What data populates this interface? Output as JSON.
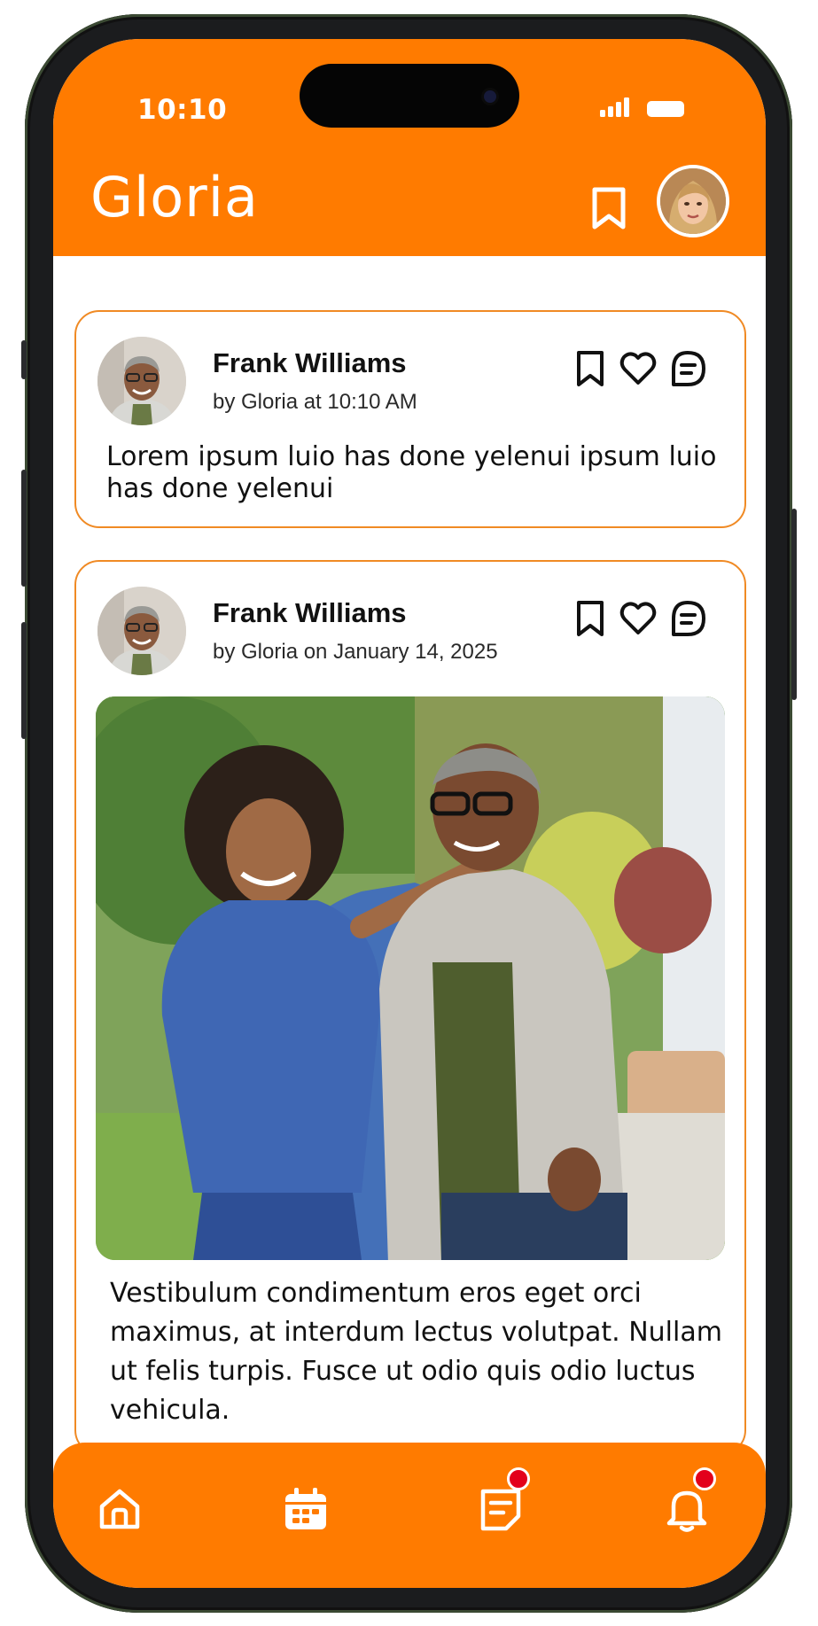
{
  "status_bar": {
    "time": "10:10"
  },
  "header": {
    "title": "Gloria"
  },
  "posts": [
    {
      "author": "Frank Williams",
      "meta": "by Gloria at 10:10 AM",
      "text": "Lorem ipsum luio has done yelenui ipsum luio has done yelenui"
    },
    {
      "author": "Frank Williams",
      "meta": "by Gloria on January 14, 2025",
      "text": "Vestibulum condimentum eros eget orci maximus, at interdum lectus volutpat. Nullam ut felis turpis. Fusce ut odio quis odio luctus vehicula."
    }
  ],
  "nav": {
    "items": [
      {
        "icon": "home-icon",
        "badge": false
      },
      {
        "icon": "calendar-icon",
        "badge": false
      },
      {
        "icon": "notes-icon",
        "badge": true
      },
      {
        "icon": "bell-icon",
        "badge": true
      }
    ]
  },
  "colors": {
    "brand": "#ff7b00",
    "card_border": "#f08a24",
    "badge": "#e3001b"
  }
}
